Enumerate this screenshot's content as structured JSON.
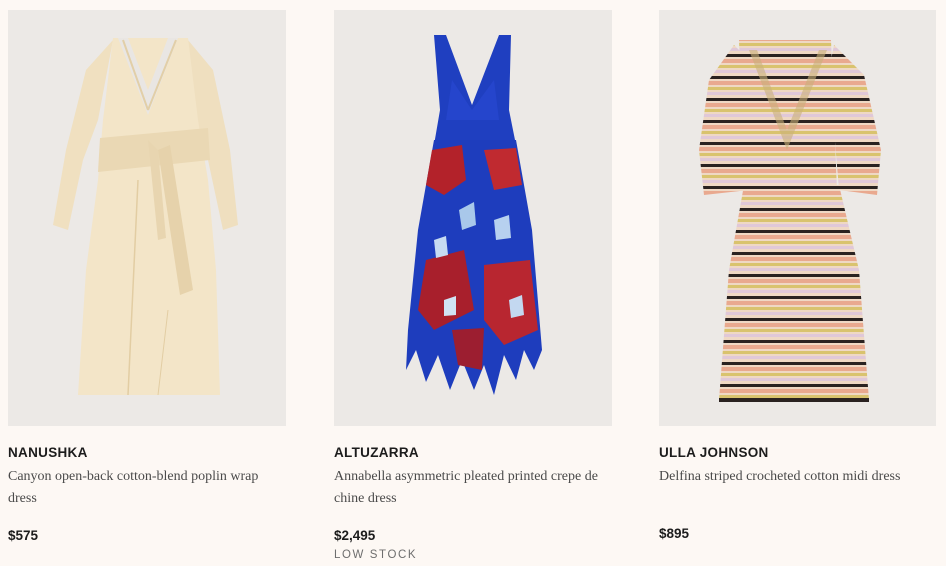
{
  "products": [
    {
      "brand": "NANUSHKA",
      "name": "Canyon open-back cotton-blend poplin wrap dress",
      "price": "$575",
      "image": "cream-wrap-dress-image"
    },
    {
      "brand": "ALTUZARRA",
      "name": "Annabella asymmetric pleated printed crepe de chine dress",
      "price": "$2,495",
      "stock": "LOW STOCK",
      "image": "blue-red-printed-dress-image"
    },
    {
      "brand": "ULLA JOHNSON",
      "name": "Delfina striped crocheted cotton midi dress",
      "price": "$895",
      "image": "striped-crochet-dress-image"
    }
  ],
  "colors": {
    "background": "#fdf8f4",
    "image_background": "#ece9e6",
    "text": "#1c1c1c",
    "secondary_text": "#4a4a4a"
  }
}
